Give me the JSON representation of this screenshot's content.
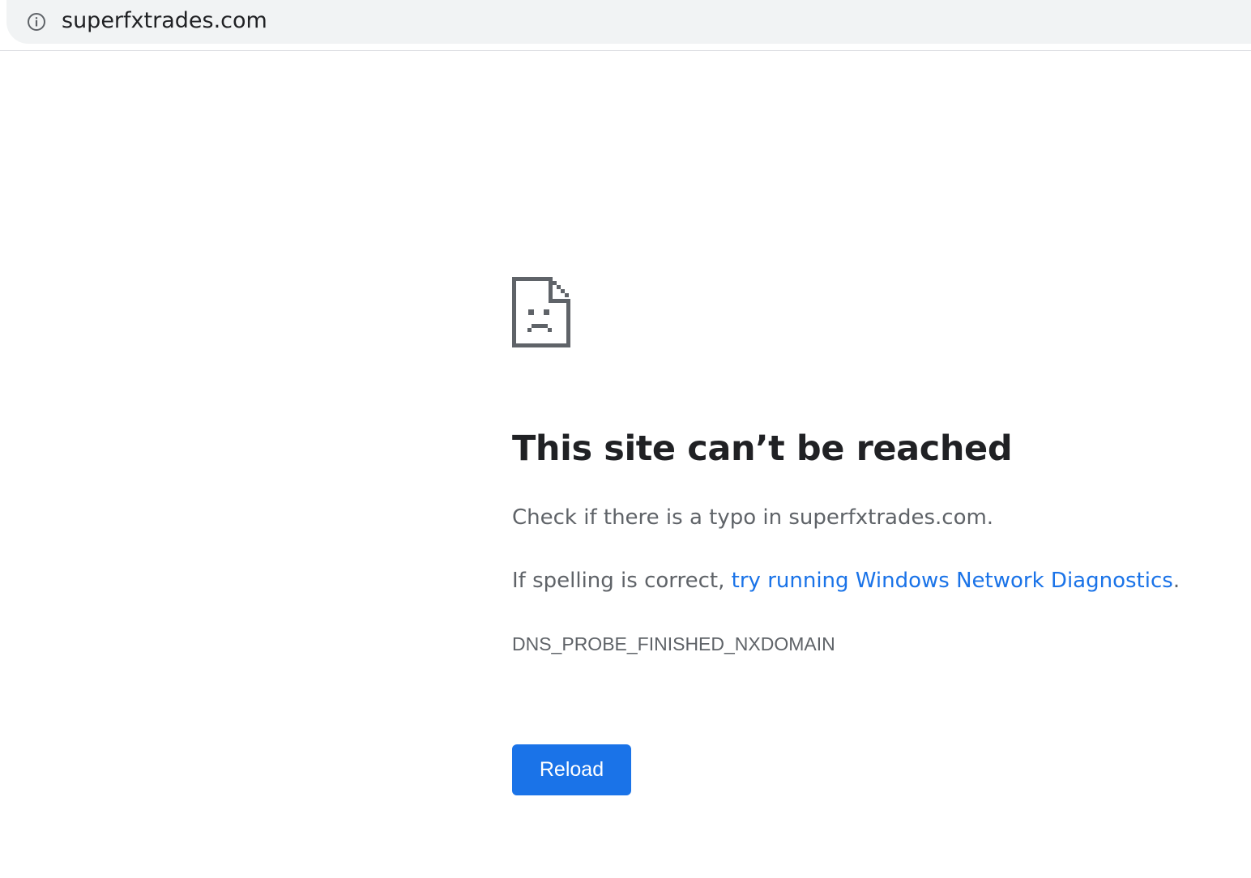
{
  "address_bar": {
    "url": "superfxtrades.com",
    "icon": "info-icon"
  },
  "error": {
    "icon": "sad-page-icon",
    "title": "This site can’t be reached",
    "line1": "Check if there is a typo in superfxtrades.com.",
    "line2_prefix": "If spelling is correct, ",
    "line2_link": "try running Windows Network Diagnostics",
    "line2_suffix": ".",
    "code": "DNS_PROBE_FINISHED_NXDOMAIN",
    "reload_label": "Reload"
  },
  "colors": {
    "accent": "#1a73e8",
    "heading": "#202124",
    "body_text": "#5f6368",
    "address_bar_bg": "#f1f3f4"
  }
}
